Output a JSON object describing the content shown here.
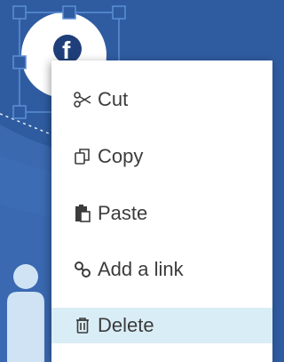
{
  "canvas": {
    "background_color": "#2f5ca1",
    "avatar_color": "#ffffff",
    "selection_color": "#5b8fd6"
  },
  "context_menu": {
    "items": [
      {
        "id": "cut",
        "label": "Cut",
        "icon": "scissors-icon"
      },
      {
        "id": "copy",
        "label": "Copy",
        "icon": "copy-icon"
      },
      {
        "id": "paste",
        "label": "Paste",
        "icon": "paste-icon"
      },
      {
        "id": "link",
        "label": "Add a link",
        "icon": "link-icon"
      },
      {
        "id": "delete",
        "label": "Delete",
        "icon": "trash-icon",
        "highlighted": true
      }
    ],
    "highlight_color": "#d9edf6",
    "text_color": "#3c3c3c"
  }
}
